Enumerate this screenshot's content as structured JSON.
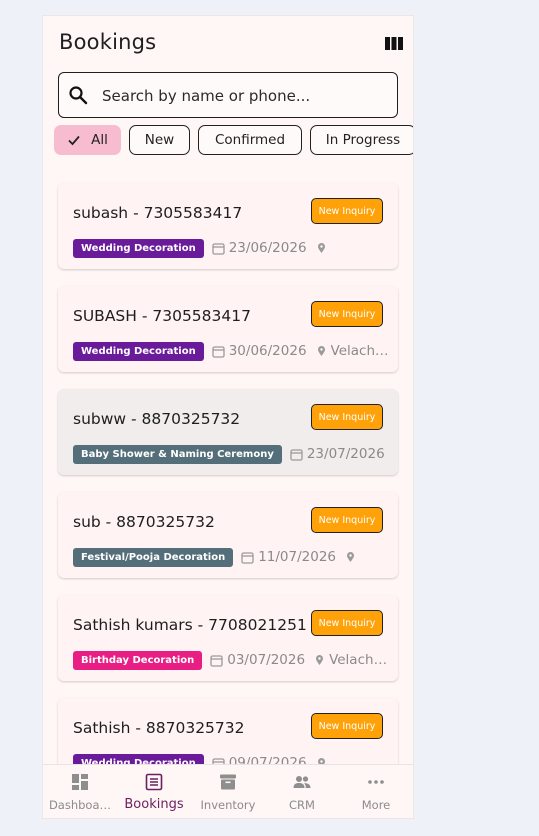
{
  "header": {
    "title": "Bookings",
    "columns_icon": "view-columns-icon"
  },
  "search": {
    "placeholder": "Search by name or phone..."
  },
  "filters": [
    {
      "label": "All",
      "selected": true
    },
    {
      "label": "New",
      "selected": false
    },
    {
      "label": "Confirmed",
      "selected": false
    },
    {
      "label": "In Progress",
      "selected": false
    }
  ],
  "bookings": [
    {
      "name": "subash - 7305583417",
      "status": "New Inquiry",
      "tag": "Wedding Decoration",
      "tag_color": "#6a1b9a",
      "date": "23/06/2026",
      "location": ""
    },
    {
      "name": "SUBASH - 7305583417",
      "status": "New Inquiry",
      "tag": "Wedding Decoration",
      "tag_color": "#6a1b9a",
      "date": "30/06/2026",
      "location": "Velach…"
    },
    {
      "name": "subww - 8870325732",
      "status": "New Inquiry",
      "tag": "Baby Shower & Naming Ceremony",
      "tag_color": "#546e7a",
      "date": "23/07/2026",
      "location": ""
    },
    {
      "name": "sub - 8870325732",
      "status": "New Inquiry",
      "tag": "Festival/Pooja Decoration",
      "tag_color": "#546e7a",
      "date": "11/07/2026",
      "location": ""
    },
    {
      "name": "Sathish kumars - 7708021251",
      "status": "New Inquiry",
      "tag": "Birthday Decoration",
      "tag_color": "#e91e84",
      "date": "03/07/2026",
      "location": "Velache…"
    },
    {
      "name": "Sathish - 8870325732",
      "status": "New Inquiry",
      "tag": "Wedding Decoration",
      "tag_color": "#6a1b9a",
      "date": "09/07/2026",
      "location": ""
    }
  ],
  "nav": [
    {
      "label": "Dashboa…",
      "icon": "dashboard-icon",
      "active": false
    },
    {
      "label": "Bookings",
      "icon": "bookings-icon",
      "active": true
    },
    {
      "label": "Inventory",
      "icon": "inventory-icon",
      "active": false
    },
    {
      "label": "CRM",
      "icon": "people-icon",
      "active": false
    },
    {
      "label": "More",
      "icon": "more-icon",
      "active": false
    }
  ],
  "colors": {
    "accent": "#6b1f5e",
    "status": "#ffa20a",
    "chip_selected": "#f7bcd0"
  }
}
